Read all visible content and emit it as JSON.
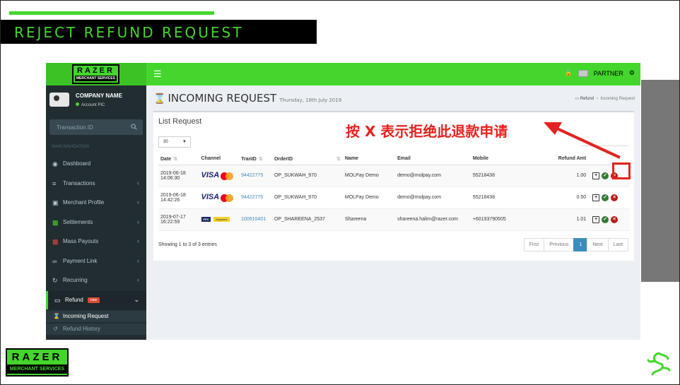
{
  "slide": {
    "title": "REJECT REFUND REQUEST",
    "accent_color": "#44d62c",
    "annotation": "按 X 表示拒绝此退款申请"
  },
  "brand": {
    "logo_top": "RAZER",
    "logo_bottom": "MERCHANT SERVICES"
  },
  "topbar": {
    "menu_icon": "hamburger-icon",
    "user_label": "PARTNER"
  },
  "user_panel": {
    "company": "COMPANY NAME",
    "status": "Account PIC"
  },
  "sidebar": {
    "search_placeholder": "Transaction ID",
    "nav_header": "MAIN NAVIGATION",
    "items": [
      {
        "label": "Dashboard",
        "icon": "dashboard-icon"
      },
      {
        "label": "Transactions",
        "icon": "cart-icon"
      },
      {
        "label": "Merchant Profile",
        "icon": "profile-icon"
      },
      {
        "label": "Settlements",
        "icon": "money-icon"
      },
      {
        "label": "Mass Payouts",
        "icon": "payout-icon"
      },
      {
        "label": "Payment Link",
        "icon": "link-icon"
      },
      {
        "label": "Recurring",
        "icon": "refresh-icon"
      },
      {
        "label": "Refund",
        "icon": "refund-icon",
        "badge": "new"
      }
    ],
    "sub_items": [
      {
        "label": "Incoming Request",
        "icon": "hourglass-icon"
      },
      {
        "label": "Refund History",
        "icon": "history-icon"
      }
    ]
  },
  "page": {
    "title": "INCOMING REQUEST",
    "date": "Thursday, 18th July 2019",
    "breadcrumb": [
      "Refund",
      "Incoming Request"
    ]
  },
  "box": {
    "title": "List Request",
    "page_length": "30"
  },
  "table": {
    "headers": [
      "Date",
      "Channel",
      "TranID",
      "OrderID",
      "Name",
      "Email",
      "Mobile",
      "Refund Amt",
      ""
    ],
    "rows": [
      {
        "date": "2019-06-18",
        "time": "14:06:30",
        "channel": "visa-mastercard",
        "visa_text": "VISA",
        "tranid": "94422775",
        "orderid": "OP_SUKWAH_970",
        "name": "MOLPay Demo",
        "email": "demo@molpay.com",
        "mobile": "55218438",
        "amount": "1.00"
      },
      {
        "date": "2019-06-18",
        "time": "14:42:26",
        "channel": "visa-mastercard",
        "visa_text": "VISA",
        "tranid": "94422775",
        "orderid": "OP_SUKWAH_970",
        "name": "MOLPay Demo",
        "email": "demo@molpay.com",
        "mobile": "55218438",
        "amount": "0.50"
      },
      {
        "date": "2019-07-17",
        "time": "16:22:59",
        "channel": "fpx-mybank",
        "fpx_text": "FPX",
        "mybank_text": "Maybank",
        "tranid": "100610401",
        "orderid": "OP_SHAREENA_2537",
        "name": "Shareena",
        "email": "shareena.halim@razer.com",
        "mobile": "+60193790505",
        "amount": "1.01"
      }
    ],
    "info": "Showing 1 to 3 of 3 entries",
    "pager": {
      "first": "First",
      "previous": "Previous",
      "current": "1",
      "next": "Next",
      "last": "Last"
    }
  }
}
